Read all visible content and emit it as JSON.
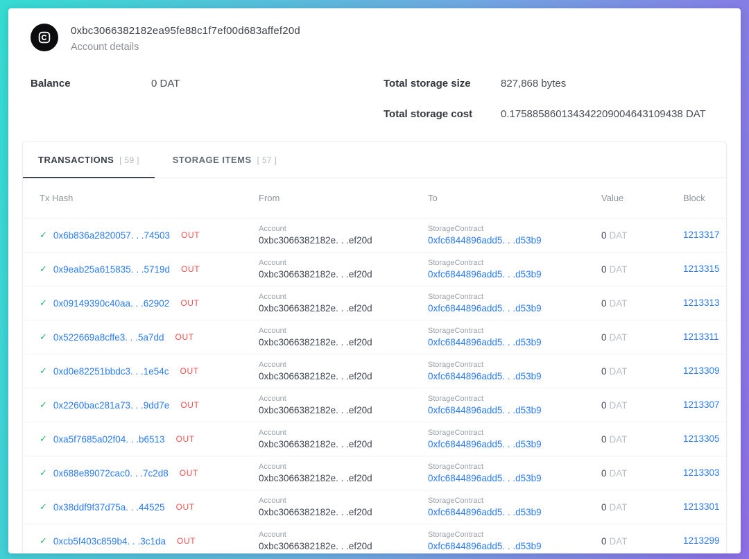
{
  "colors": {
    "gradient_left": "#35dcd2",
    "gradient_right": "#8d6fe6",
    "link_blue": "#2b7bf5",
    "out_badge_red": "#fb4e4e",
    "success_green": "#25b864",
    "avatar_background": "#0c0c0e"
  },
  "header": {
    "address": "0xbc3066382182ea95fe88c1f7ef00d683affef20d",
    "subtitle": "Account details",
    "avatar_icon": "identicon-rounded-square-c"
  },
  "summary": {
    "balance_label": "Balance",
    "balance_value": "0 DAT",
    "storage_size_label": "Total storage size",
    "storage_size_value": "827,868 bytes",
    "storage_cost_label": "Total storage cost",
    "storage_cost_value": "0.175885860134342209004643109438 DAT"
  },
  "tabs": [
    {
      "label": "TRANSACTIONS",
      "count": "[ 59 ]",
      "active": true
    },
    {
      "label": "STORAGE ITEMS",
      "count": "[ 57 ]",
      "active": false
    }
  ],
  "table": {
    "columns": [
      "Tx Hash",
      "From",
      "To",
      "Value",
      "Block"
    ],
    "rows": [
      {
        "status_icon": "check",
        "hash": "0x6b836a2820057. . .74503",
        "direction": "OUT",
        "from_label": "Account",
        "from_address": "0xbc3066382182e. . .ef20d",
        "to_label": "StorageContract",
        "to_address": "0xfc6844896add5. . .d53b9",
        "value": "0",
        "unit": "DAT",
        "block": "1213317"
      },
      {
        "status_icon": "check",
        "hash": "0x9eab25a615835. . .5719d",
        "direction": "OUT",
        "from_label": "Account",
        "from_address": "0xbc3066382182e. . .ef20d",
        "to_label": "StorageContract",
        "to_address": "0xfc6844896add5. . .d53b9",
        "value": "0",
        "unit": "DAT",
        "block": "1213315"
      },
      {
        "status_icon": "check",
        "hash": "0x09149390c40aa. . .62902",
        "direction": "OUT",
        "from_label": "Account",
        "from_address": "0xbc3066382182e. . .ef20d",
        "to_label": "StorageContract",
        "to_address": "0xfc6844896add5. . .d53b9",
        "value": "0",
        "unit": "DAT",
        "block": "1213313"
      },
      {
        "status_icon": "check",
        "hash": "0x522669a8cffe3. . .5a7dd",
        "direction": "OUT",
        "from_label": "Account",
        "from_address": "0xbc3066382182e. . .ef20d",
        "to_label": "StorageContract",
        "to_address": "0xfc6844896add5. . .d53b9",
        "value": "0",
        "unit": "DAT",
        "block": "1213311"
      },
      {
        "status_icon": "check",
        "hash": "0xd0e82251bbdc3. . .1e54c",
        "direction": "OUT",
        "from_label": "Account",
        "from_address": "0xbc3066382182e. . .ef20d",
        "to_label": "StorageContract",
        "to_address": "0xfc6844896add5. . .d53b9",
        "value": "0",
        "unit": "DAT",
        "block": "1213309"
      },
      {
        "status_icon": "check",
        "hash": "0x2260bac281a73. . .9dd7e",
        "direction": "OUT",
        "from_label": "Account",
        "from_address": "0xbc3066382182e. . .ef20d",
        "to_label": "StorageContract",
        "to_address": "0xfc6844896add5. . .d53b9",
        "value": "0",
        "unit": "DAT",
        "block": "1213307"
      },
      {
        "status_icon": "check",
        "hash": "0xa5f7685a02f04. . .b6513",
        "direction": "OUT",
        "from_label": "Account",
        "from_address": "0xbc3066382182e. . .ef20d",
        "to_label": "StorageContract",
        "to_address": "0xfc6844896add5. . .d53b9",
        "value": "0",
        "unit": "DAT",
        "block": "1213305"
      },
      {
        "status_icon": "check",
        "hash": "0x688e89072cac0. . .7c2d8",
        "direction": "OUT",
        "from_label": "Account",
        "from_address": "0xbc3066382182e. . .ef20d",
        "to_label": "StorageContract",
        "to_address": "0xfc6844896add5. . .d53b9",
        "value": "0",
        "unit": "DAT",
        "block": "1213303"
      },
      {
        "status_icon": "check",
        "hash": "0x38ddf9f37d75a. . .44525",
        "direction": "OUT",
        "from_label": "Account",
        "from_address": "0xbc3066382182e. . .ef20d",
        "to_label": "StorageContract",
        "to_address": "0xfc6844896add5. . .d53b9",
        "value": "0",
        "unit": "DAT",
        "block": "1213301"
      },
      {
        "status_icon": "check",
        "hash": "0xcb5f403c859b4. . .3c1da",
        "direction": "OUT",
        "from_label": "Account",
        "from_address": "0xbc3066382182e. . .ef20d",
        "to_label": "StorageContract",
        "to_address": "0xfc6844896add5. . .d53b9",
        "value": "0",
        "unit": "DAT",
        "block": "1213299"
      }
    ]
  }
}
